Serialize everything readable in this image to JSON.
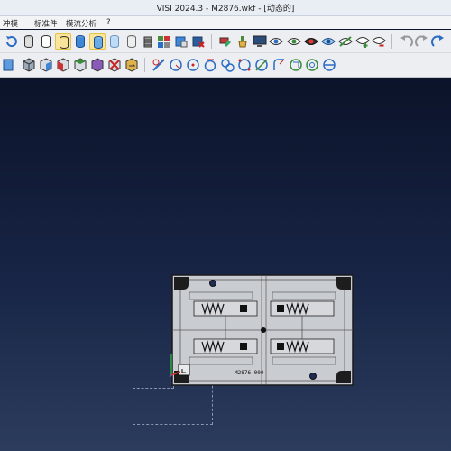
{
  "window": {
    "title": "VISI 2024.3 - M2876.wkf - [动态的]"
  },
  "menu": {
    "items": [
      {
        "label": "冲模"
      },
      {
        "label": "标准件"
      },
      {
        "label": "模流分析"
      },
      {
        "label": "?"
      }
    ]
  },
  "toolbar1": {
    "icons": [
      "rotate-view-icon",
      "cylinder-icon",
      "cylinder-outline-icon",
      "cylinder-selected-icon",
      "cylinder-blue-icon",
      "cylinder-yellow-icon",
      "cylinder-light-icon",
      "cylinder-grey-icon",
      "cylinder-stack-icon",
      "multi-cylinder-icon",
      "layer-cylinder-icon",
      "cylinder-cross-icon",
      "paint-tool-icon",
      "clean-brush-icon",
      "render-monitor-icon",
      "eye-view-icon",
      "eye-green-icon",
      "eye-solid-icon",
      "eye-blue-icon",
      "eye-line-icon",
      "eye-add-icon",
      "eye-remove-icon",
      "undo-icon",
      "redo-icon",
      "redo-alt-icon"
    ]
  },
  "toolbar2": {
    "icons": [
      "cube-view-icon",
      "cube-shade-icon",
      "cube-red-icon",
      "cube-green-icon",
      "cube-purple-icon",
      "cube-cross-icon",
      "cube-arrow-icon",
      "line-tool-icon",
      "circle-point-icon",
      "circle-arc-icon",
      "circle-center-icon",
      "circle-cross-icon",
      "circle-dots-icon",
      "circle-slash-icon",
      "circle-corner-icon",
      "circle-arrow-icon",
      "circle-tangent-icon",
      "circle-minus-icon"
    ]
  },
  "viewport": {
    "model_label": "M2876-000"
  }
}
